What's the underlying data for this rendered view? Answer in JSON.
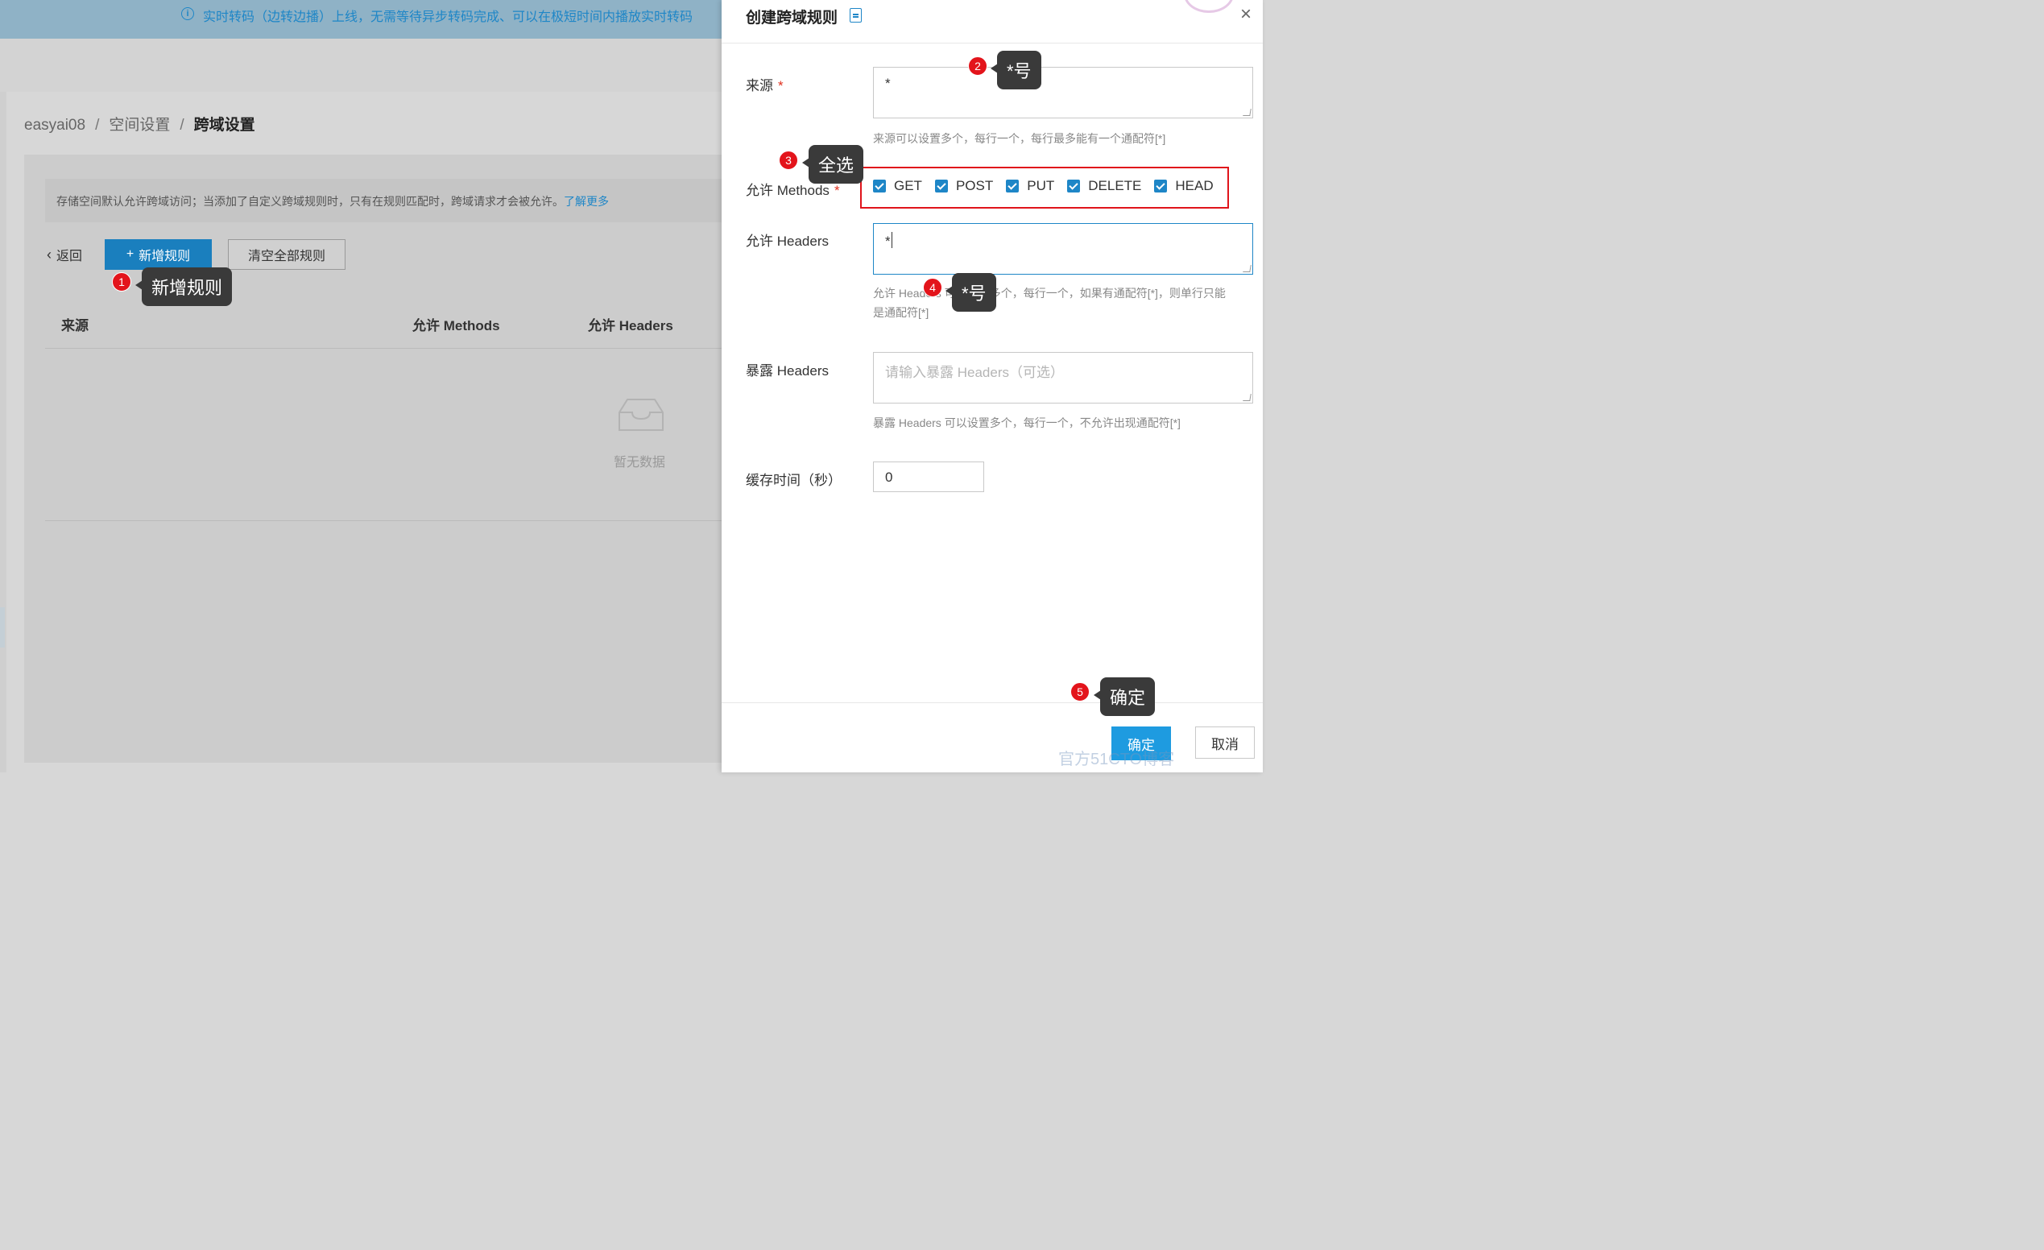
{
  "notice": {
    "text": "实时转码（边转边播）上线，无需等待异步转码完成、可以在极短时间内播放实时转码"
  },
  "breadcrumb": {
    "items": [
      "easyai08",
      "空间设置",
      "跨域设置"
    ],
    "separator": "/"
  },
  "tip": {
    "text": "存储空间默认允许跨域访问；当添加了自定义跨域规则时，只有在规则匹配时，跨域请求才会被允许。",
    "link": "了解更多"
  },
  "toolbar": {
    "back_label": "返回",
    "add_label": "新增规则",
    "clear_label": "清空全部规则"
  },
  "table": {
    "columns": [
      "来源",
      "允许 Methods",
      "允许 Headers"
    ],
    "empty_text": "暂无数据"
  },
  "drawer": {
    "title": "创建跨域规则",
    "close_label": "×",
    "origin": {
      "label": "来源",
      "required": "*",
      "value": "*",
      "help": "来源可以设置多个，每行一个，每行最多能有一个通配符[*]"
    },
    "methods": {
      "label": "允许 Methods",
      "required": "*",
      "options": [
        {
          "label": "GET",
          "checked": true
        },
        {
          "label": "POST",
          "checked": true
        },
        {
          "label": "PUT",
          "checked": true
        },
        {
          "label": "DELETE",
          "checked": true
        },
        {
          "label": "HEAD",
          "checked": true
        }
      ]
    },
    "allow_headers": {
      "label": "允许 Headers",
      "value": "*",
      "help_line1": "允许 Headers 可以设置多个，每行一个，如果有通配符[*]，则单行只能",
      "help_line2": "是通配符[*]"
    },
    "expose_headers": {
      "label": "暴露 Headers",
      "placeholder": "请输入暴露 Headers（可选）",
      "help": "暴露 Headers 可以设置多个，每行一个，不允许出现通配符[*]"
    },
    "cache": {
      "label": "缓存时间（秒）",
      "value": "0"
    },
    "ok_label": "确定",
    "cancel_label": "取消",
    "watermark": "官方51CTO博客"
  },
  "annotations": [
    {
      "num": "1",
      "text": "新增规则"
    },
    {
      "num": "2",
      "text": "*号"
    },
    {
      "num": "3",
      "text": "全选"
    },
    {
      "num": "4",
      "text": "*号"
    },
    {
      "num": "5",
      "text": "确定"
    }
  ],
  "colors": {
    "accent": "#1e86c7",
    "required": "#e0311f",
    "annotation_red": "#e3141b",
    "callout_bg": "#3a3a3a"
  }
}
